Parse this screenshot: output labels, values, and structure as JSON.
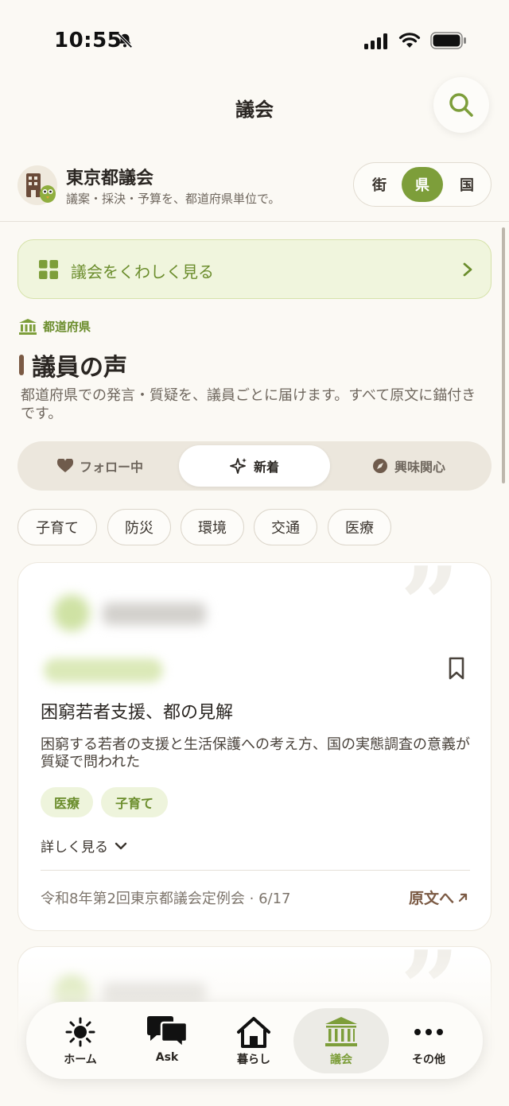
{
  "status": {
    "time": "10:55"
  },
  "nav": {
    "title": "議会"
  },
  "council": {
    "name": "東京都議会",
    "subtitle": "議案・採決・予算を、都道府県単位で。",
    "scopes": [
      {
        "label": "街",
        "active": false
      },
      {
        "label": "県",
        "active": true
      },
      {
        "label": "国",
        "active": false
      }
    ]
  },
  "banner": {
    "label": "議会をくわしく見る"
  },
  "section": {
    "kicker": "都道府県",
    "title": "議員の声",
    "description": "都道府県での発言・質疑を、議員ごとに届けます。すべて原文に錨付きです。"
  },
  "segments": [
    {
      "label": "フォロー中",
      "icon": "heart-icon"
    },
    {
      "label": "新着",
      "icon": "sparkle-icon",
      "active": true
    },
    {
      "label": "興味関心",
      "icon": "compass-icon"
    }
  ],
  "topics": [
    "子育て",
    "防災",
    "環境",
    "交通",
    "医療"
  ],
  "cards": [
    {
      "title": "困窮若者支援、都の見解",
      "summary": "困窮する若者の支援と生活保護への考え方、国の実態調査の意義が質疑で問われた",
      "tags": [
        "医療",
        "子育て"
      ],
      "detail_label": "詳しく見る",
      "source": "令和8年第2回東京都議会定例会 · 6/17",
      "original_label": "原文へ"
    }
  ],
  "tabs": [
    {
      "label": "ホーム",
      "icon": "sun-icon"
    },
    {
      "label": "Ask",
      "icon": "chat-bubbles-icon"
    },
    {
      "label": "暮らし",
      "icon": "house-icon"
    },
    {
      "label": "議会",
      "icon": "capitol-icon",
      "active": true
    },
    {
      "label": "その他",
      "icon": "more-icon"
    }
  ],
  "colors": {
    "accent": "#7d9e3a",
    "accent_light": "#f0f5dd",
    "brown": "#7b5a44",
    "background": "#fbf9f4"
  }
}
